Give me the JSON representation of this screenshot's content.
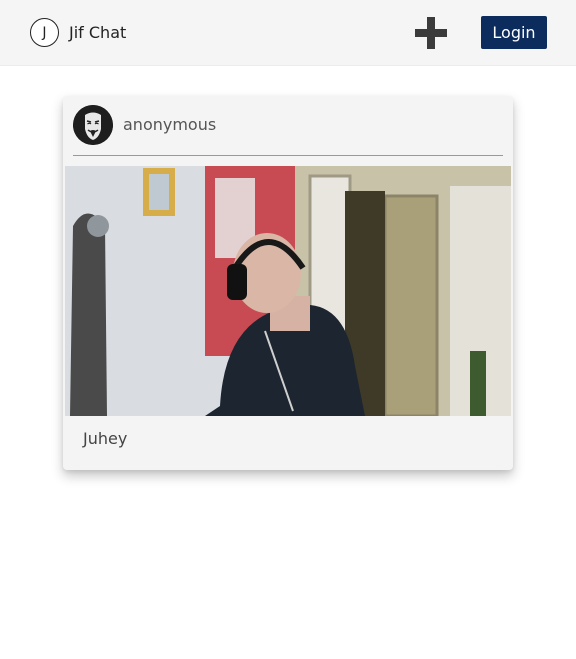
{
  "navbar": {
    "logo_letter": "J",
    "brand_name": "Jif Chat",
    "add_icon": "plus-icon",
    "login_label": "Login",
    "accent_color": "#0b2c5c"
  },
  "post": {
    "username": "anonymous",
    "avatar_icon": "guy-fawkes-mask-avatar",
    "caption": "Juhey"
  }
}
